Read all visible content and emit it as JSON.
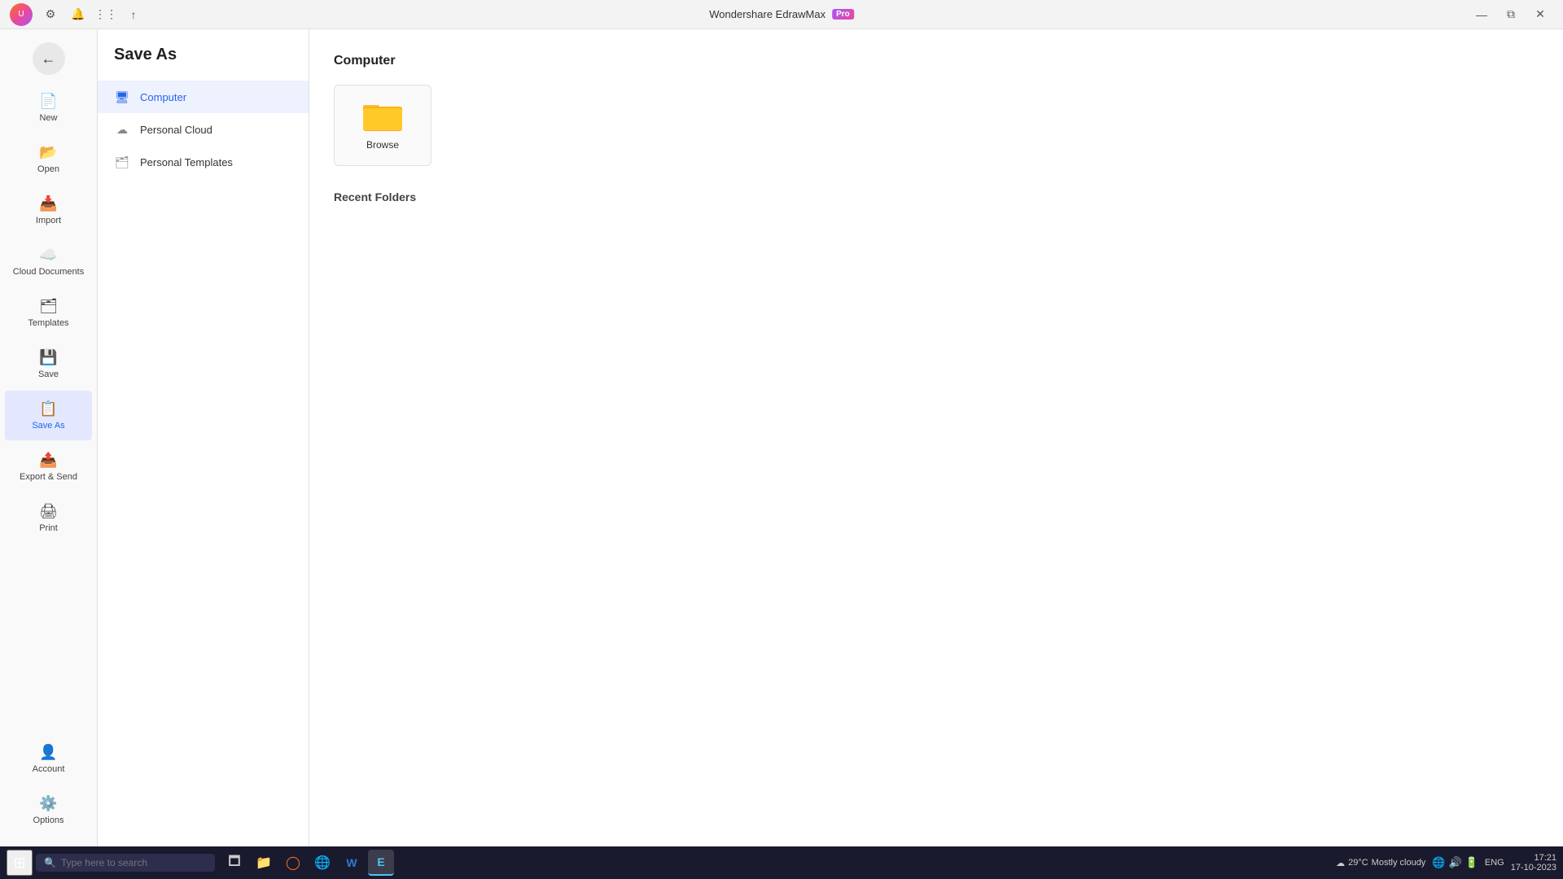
{
  "app": {
    "title": "Wondershare EdrawMax",
    "badge": "Pro"
  },
  "titlebar": {
    "controls": {
      "minimize": "—",
      "restore": "⧉",
      "close": "✕"
    }
  },
  "sidebar": {
    "back_label": "←",
    "items": [
      {
        "id": "new",
        "label": "New",
        "icon": "📄",
        "active": false
      },
      {
        "id": "open",
        "label": "Open",
        "icon": "📂",
        "active": false
      },
      {
        "id": "import",
        "label": "Import",
        "icon": "📥",
        "active": false
      },
      {
        "id": "cloud",
        "label": "Cloud Documents",
        "icon": "☁️",
        "active": false
      },
      {
        "id": "templates",
        "label": "Templates",
        "icon": "🗂",
        "active": false
      },
      {
        "id": "save",
        "label": "Save",
        "icon": "💾",
        "active": false
      },
      {
        "id": "saveas",
        "label": "Save As",
        "icon": "📋",
        "active": true
      },
      {
        "id": "export",
        "label": "Export & Send",
        "icon": "📤",
        "active": false
      },
      {
        "id": "print",
        "label": "Print",
        "icon": "🖨",
        "active": false
      }
    ],
    "bottom_items": [
      {
        "id": "account",
        "label": "Account",
        "icon": "👤"
      },
      {
        "id": "options",
        "label": "Options",
        "icon": "⚙️"
      }
    ]
  },
  "save_as_panel": {
    "title": "Save As",
    "nav_items": [
      {
        "id": "computer",
        "label": "Computer",
        "type": "computer",
        "active": true
      },
      {
        "id": "personal_cloud",
        "label": "Personal Cloud",
        "type": "cloud",
        "active": false
      },
      {
        "id": "personal_templates",
        "label": "Personal Templates",
        "type": "folder",
        "active": false
      }
    ]
  },
  "main_content": {
    "section_title": "Computer",
    "browse_label": "Browse",
    "recent_folders_title": "Recent Folders"
  },
  "taskbar": {
    "search_placeholder": "Type here to search",
    "apps": [
      {
        "id": "start",
        "icon": "⊞"
      },
      {
        "id": "task-view",
        "icon": "🗖"
      },
      {
        "id": "explorer",
        "icon": "📁"
      },
      {
        "id": "chrome",
        "icon": "🌐"
      },
      {
        "id": "word",
        "icon": "W"
      },
      {
        "id": "edrawmax",
        "icon": "E"
      }
    ],
    "weather": {
      "temp": "29°C",
      "condition": "Mostly cloudy",
      "icon": "☁"
    },
    "clock": {
      "time": "17:21",
      "date": "17-10-2023"
    },
    "lang": "ENG"
  }
}
